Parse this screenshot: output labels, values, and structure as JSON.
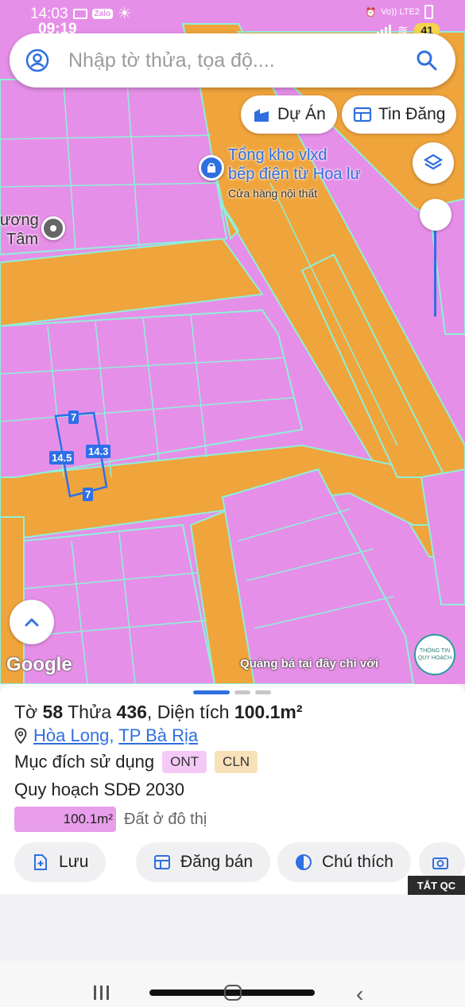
{
  "status_bar": {
    "time_top": "14:03",
    "carrier": "Vo)) LTE2",
    "time_overlay": "09:19",
    "battery": "41"
  },
  "search": {
    "placeholder": "Nhập tờ thửa, tọa độ...."
  },
  "map_buttons": {
    "du_an": "Dự Án",
    "tin_dang": "Tin Đăng"
  },
  "map_labels": {
    "poi_name_line1": "Tổng kho vlxd",
    "poi_name_line2": "bếp điện từ Hoa lư",
    "poi_category": "Cửa hàng nội thất",
    "poi_left_line1": "ương",
    "poi_left_line2": "Tâm"
  },
  "parcel_dims": {
    "top": "7",
    "left": "14.5",
    "right": "14.3",
    "bottom": "7"
  },
  "map_footer": {
    "google": "Google",
    "ads": "Quảng bá tại đây chỉ với",
    "badge_line1": "THÔNG TIN",
    "badge_line2": "QUY HOẠCH"
  },
  "colors": {
    "residential": "#e68fe8",
    "road": "#f0a43c",
    "lines": "#8ff0d8",
    "accent": "#2f6fe0"
  },
  "parcel": {
    "sheet_label": "Tờ",
    "sheet_no": "58",
    "plot_label": "Thửa",
    "plot_no": "436",
    "area_label": "Diện tích",
    "area": "100.1m²",
    "ward": "Hòa Long",
    "city": "TP Bà Rịa",
    "usage_label": "Mục đích sử dụng",
    "usage_codes": [
      "ONT",
      "CLN"
    ],
    "plan_title": "Quy hoạch SDĐ 2030",
    "plan_area": "100.1m²",
    "plan_type": "Đất ở đô thị"
  },
  "actions": {
    "save": "Lưu",
    "sell": "Đăng bán",
    "note": "Chú thích"
  },
  "ad_toggle": "TẮT QC"
}
